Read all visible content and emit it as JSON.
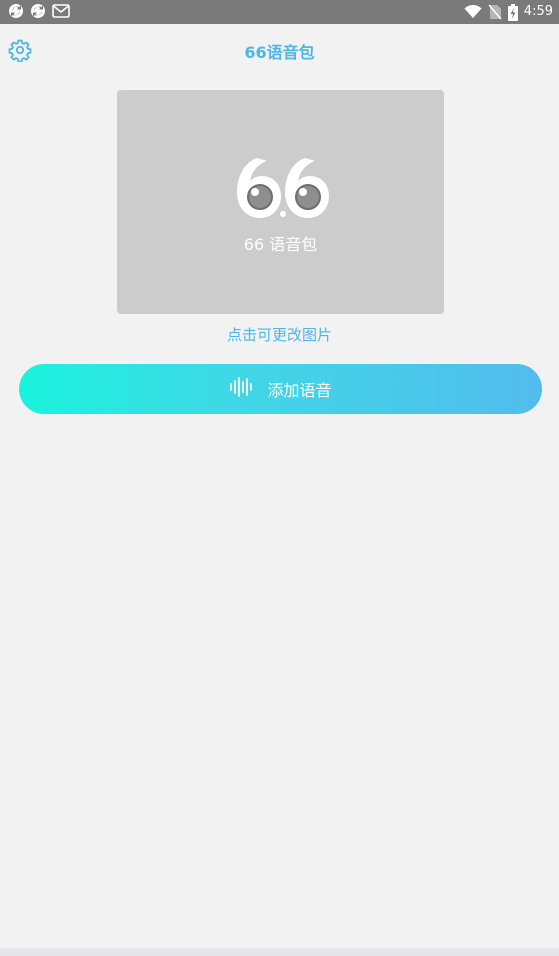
{
  "status_bar": {
    "time": "4:59",
    "left_icons": [
      "sync-icon",
      "sync-icon",
      "mail-icon"
    ],
    "right_icons": [
      "wifi-icon",
      "no-sim-icon",
      "battery-charging-icon"
    ]
  },
  "header": {
    "title": "66语音包",
    "settings_icon": "gear-icon"
  },
  "cover": {
    "logo_text": "66",
    "caption": "66 语音包",
    "change_hint": "点击可更改图片"
  },
  "actions": {
    "add_voice_label": "添加语音",
    "add_voice_icon": "waveform-icon"
  },
  "colors": {
    "accent": "#4fb6e4",
    "gradient_start": "#1af3dd",
    "gradient_end": "#52bcee",
    "cover_bg": "#cccccc",
    "page_bg": "#f2f2f2"
  }
}
